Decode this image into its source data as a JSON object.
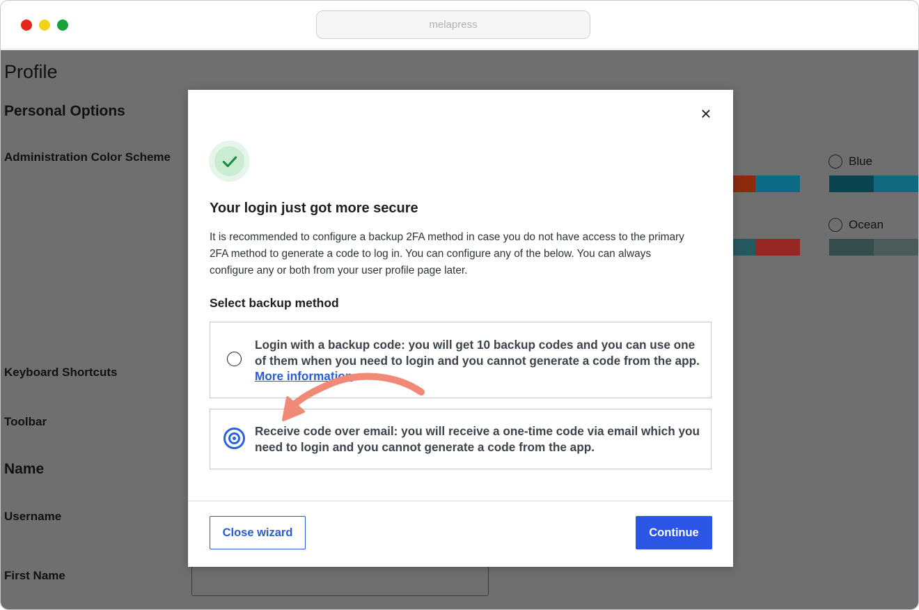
{
  "browser": {
    "url_text": "melapress"
  },
  "background_page": {
    "title": "Profile",
    "personal_options_heading": "Personal Options",
    "color_scheme_label": "Administration Color Scheme",
    "keyboard_shortcuts_label": "Keyboard Shortcuts",
    "toolbar_label": "Toolbar",
    "name_heading": "Name",
    "username_label": "Username",
    "first_name_label": "First Name",
    "schemes": [
      {
        "label": "Blue",
        "colors": [
          "#0b4451",
          "#116a80",
          "#19778b"
        ]
      },
      {
        "label": "Ocean",
        "colors": [
          "#354c4b",
          "#4b5b5a",
          "#5c6c6b"
        ]
      }
    ],
    "partial_swatches": [
      {
        "colors": [
          "#8c2a0c",
          "#0d6a84"
        ]
      },
      {
        "colors": [
          "#24595f",
          "#952624"
        ]
      }
    ]
  },
  "modal": {
    "close_label": "×",
    "title": "Your login just got more secure",
    "description": "It is recommended to configure a backup 2FA method in case you do not have access to the primary 2FA method to generate a code to log in. You can configure any of the below. You can always configure any or both from your user profile page later.",
    "select_label": "Select backup method",
    "options": [
      {
        "text": "Login with a backup code: you will get 10 backup codes and you can use one of them when you need to login and you cannot generate a code from the app.",
        "link_text": "More information",
        "selected": false
      },
      {
        "text": "Receive code over email: you will receive a one-time code via email which you need to login and you cannot generate a code from the app.",
        "selected": true
      }
    ],
    "close_wizard_label": "Close wizard",
    "continue_label": "Continue"
  },
  "colors": {
    "accent": "#2a55e5",
    "success": "#1a8a3c",
    "annotation_arrow": "#f08a76"
  }
}
